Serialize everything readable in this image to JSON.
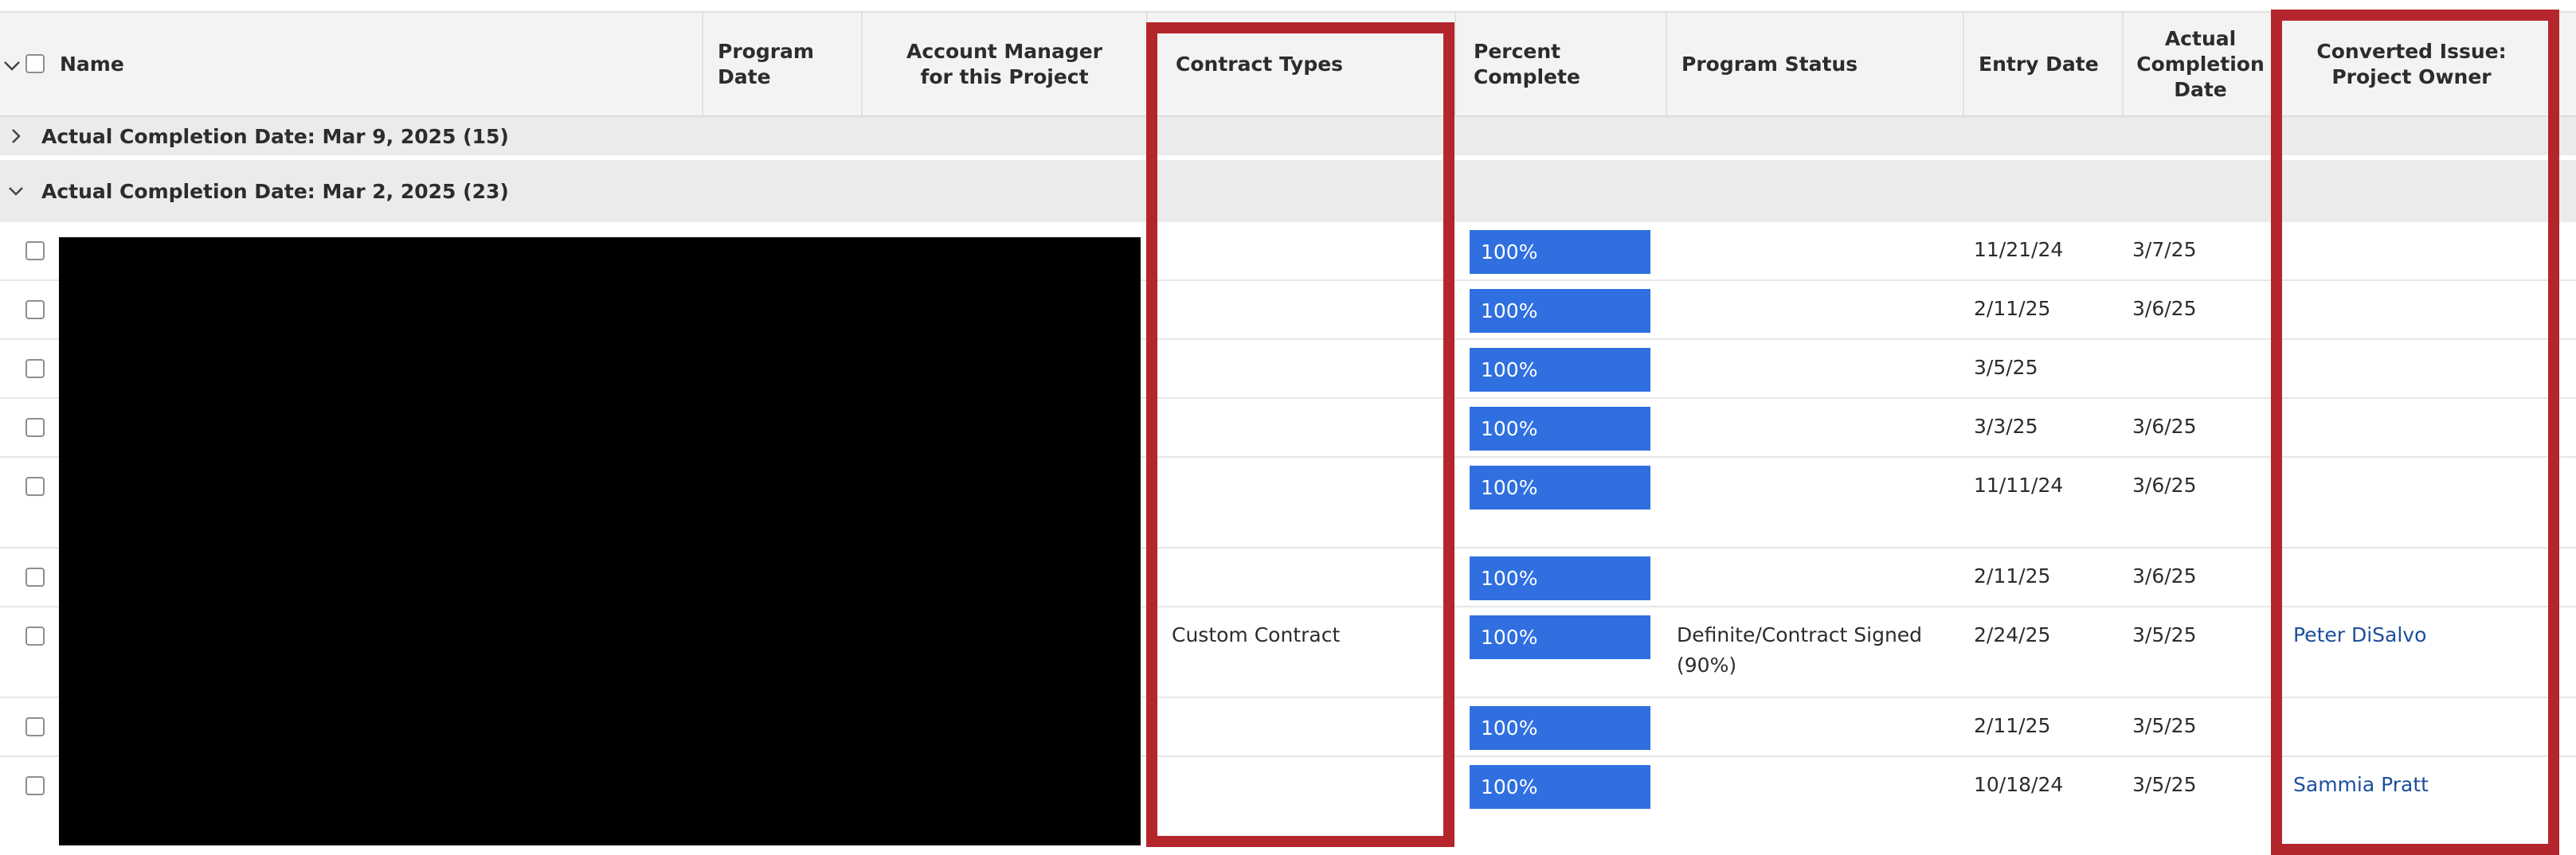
{
  "columns": {
    "name": "Name",
    "program_date": "Program Date",
    "account_manager": "Account Manager for this Project",
    "contract_types": "Contract Types",
    "percent_complete": "Percent Complete",
    "program_status": "Program Status",
    "entry_date": "Entry Date",
    "actual_completion_date": "Actual Completion Date",
    "converted_issue_owner": "Converted Issue: Project Owner"
  },
  "groups": [
    {
      "label": "Actual Completion Date: Mar 9, 2025 (15)",
      "expanded": false
    },
    {
      "label": "Actual Completion Date: Mar 2, 2025 (23)",
      "expanded": true
    }
  ],
  "rows": [
    {
      "contract_type": "",
      "percent": "100%",
      "percent_value": 1.0,
      "status": "",
      "entry_date": "11/21/24",
      "completion_date": "3/7/25",
      "owner": ""
    },
    {
      "contract_type": "",
      "percent": "100%",
      "percent_value": 1.0,
      "status": "",
      "entry_date": "2/11/25",
      "completion_date": "3/6/25",
      "owner": ""
    },
    {
      "contract_type": "",
      "percent": "100%",
      "percent_value": 1.0,
      "status": "",
      "entry_date": "3/5/25",
      "completion_date": "",
      "owner": ""
    },
    {
      "contract_type": "",
      "percent": "100%",
      "percent_value": 1.0,
      "status": "",
      "entry_date": "3/3/25",
      "completion_date": "3/6/25",
      "owner": ""
    },
    {
      "contract_type": "",
      "percent": "100%",
      "percent_value": 1.0,
      "status": "",
      "entry_date": "11/11/24",
      "completion_date": "3/6/25",
      "owner": ""
    },
    {
      "contract_type": "",
      "percent": "100%",
      "percent_value": 1.0,
      "status": "",
      "entry_date": "2/11/25",
      "completion_date": "3/6/25",
      "owner": ""
    },
    {
      "contract_type": "Custom Contract",
      "percent": "100%",
      "percent_value": 1.0,
      "status_line1": "Definite/Contract Signed",
      "status_line2": "(90%)",
      "entry_date": "2/24/25",
      "completion_date": "3/5/25",
      "owner": "Peter DiSalvo"
    },
    {
      "contract_type": "",
      "percent": "100%",
      "percent_value": 1.0,
      "status": "",
      "entry_date": "2/11/25",
      "completion_date": "3/5/25",
      "owner": ""
    },
    {
      "contract_type": "",
      "percent": "100%",
      "percent_value": 1.0,
      "status": "",
      "entry_date": "10/18/24",
      "completion_date": "3/5/25",
      "owner": "Sammia Pratt"
    }
  ],
  "colors": {
    "progress_bar": "#2f6fe0",
    "highlight_box": "#b4262b",
    "link": "#1b4f9c",
    "redaction": "#000000"
  }
}
